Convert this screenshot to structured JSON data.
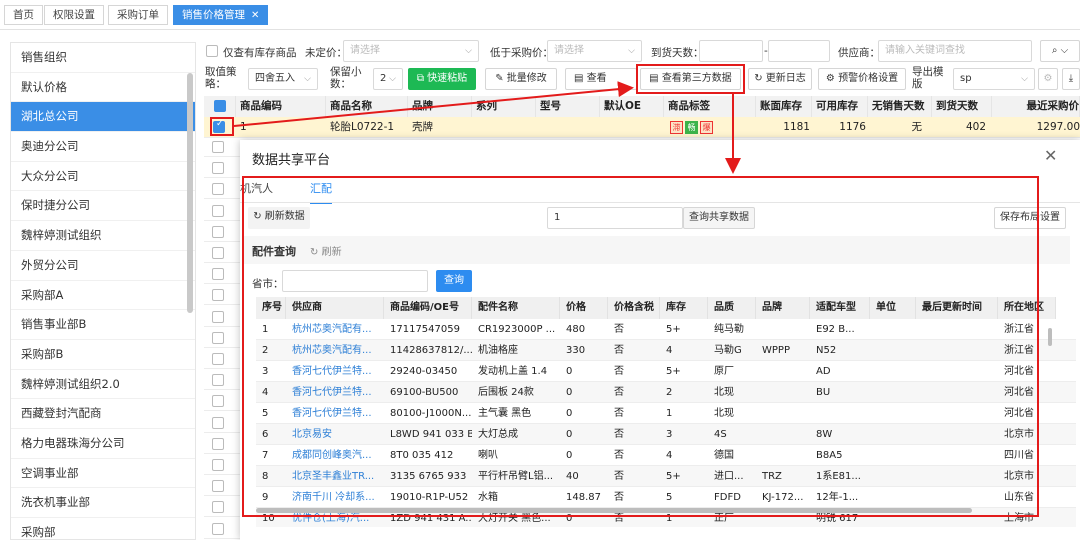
{
  "tabs": [
    {
      "label": "首页"
    },
    {
      "label": "权限设置"
    },
    {
      "label": "采购订单"
    },
    {
      "label": "销售价格管理",
      "active": true
    }
  ],
  "sidebar": {
    "items": [
      "销售组织",
      "默认价格",
      "湖北总公司",
      "奥迪分公司",
      "大众分公司",
      "保时捷分公司",
      "魏梓婷测试组织",
      "外贸分公司",
      "采购部A",
      "销售事业部B",
      "采购部B",
      "魏梓婷测试组织2.0",
      "西藏登封汽配商",
      "格力电器珠海分公司",
      "空调事业部",
      "洗衣机事业部",
      "采购部"
    ],
    "selected": 2
  },
  "filters": {
    "in_stock_only": "仅查有库存商品",
    "unpriced_label": "未定价：",
    "unpriced_placeholder": "请选择",
    "below_purchase_label": "低于采购价：",
    "below_purchase_placeholder": "请选择",
    "arrival_days_label": "到货天数：",
    "range_sep": "-",
    "supplier_label": "供应商：",
    "supplier_placeholder": "请输入关键词查找",
    "rounding_label_1": "取值策",
    "rounding_label_2": "略：",
    "rounding_value": "四舍五入",
    "decimals_label_1": "保留小",
    "decimals_label_2": "数：",
    "decimals_value": "2",
    "export_label_1": "导出模",
    "export_label_2": "版",
    "export_value": "sp"
  },
  "toolbar": {
    "quick_paste": "快速粘贴",
    "batch_edit": "批量修改",
    "view_fourth": "查看",
    "view_third_party": "查看第三方数据",
    "update_log": "更新日志",
    "price_alert": "预警价格设置"
  },
  "main_table": {
    "headers": [
      "商品编码",
      "商品名称",
      "品牌",
      "系列",
      "型号",
      "默认OE",
      "商品标签",
      "账面库存",
      "可用库存",
      "无销售天数",
      "到货天数",
      "最近采购价"
    ],
    "row1": {
      "code": "1",
      "name": "轮胎L0722-1",
      "brand": "壳牌",
      "tags": [
        "滞",
        "畅",
        "爆"
      ],
      "book_stock": "1181",
      "avail_stock": "1176",
      "no_sale_days": "无",
      "arrival_days": "402",
      "last_price": "1297.00"
    }
  },
  "modal": {
    "title": "数据共享平台",
    "tabs": [
      "机汽人",
      "汇配"
    ],
    "active_tab": 1,
    "refresh_data": "刷新数据",
    "query_input_value": "1",
    "query_shared": "查询共享数据",
    "save_layout": "保存布局设置",
    "section_title": "配件查询",
    "refresh": "刷新",
    "province_label": "省市：",
    "search": "查询",
    "headers": [
      "序号",
      "供应商",
      "商品编码/OE号",
      "配件名称",
      "价格",
      "价格含税",
      "库存",
      "品质",
      "品牌",
      "适配车型",
      "单位",
      "最后更新时间",
      "所在地区"
    ],
    "rows": [
      [
        "1",
        "杭州芯奥汽配有...",
        "17117547059",
        "CR1923000P ...",
        "480",
        "否",
        "5+",
        "纯马勒",
        "",
        "E92 B...",
        "",
        "",
        "浙江省"
      ],
      [
        "2",
        "杭州芯奥汽配有...",
        "11428637812/...",
        "机油格座",
        "330",
        "否",
        "4",
        "马勒G",
        "WPPP",
        "N52",
        "",
        "",
        "浙江省"
      ],
      [
        "3",
        "香河七代伊兰特...",
        "29240-03450",
        "发动机上盖 1.4",
        "0",
        "否",
        "5+",
        "原厂",
        "",
        "AD",
        "",
        "",
        "河北省"
      ],
      [
        "4",
        "香河七代伊兰特...",
        "69100-BU500",
        "后围板 24款",
        "0",
        "否",
        "2",
        "北现",
        "",
        "BU",
        "",
        "",
        "河北省"
      ],
      [
        "5",
        "香河七代伊兰特...",
        "80100-J1000N...",
        "主气囊 黑色",
        "0",
        "否",
        "1",
        "北现",
        "",
        "",
        "",
        "",
        "河北省"
      ],
      [
        "6",
        "北京易安",
        "L8WD 941 033 B",
        "大灯总成",
        "0",
        "否",
        "3",
        "4S",
        "",
        "8W",
        "",
        "",
        "北京市"
      ],
      [
        "7",
        "成都同创峰奥汽...",
        "8T0 035 412",
        "喇叭",
        "0",
        "否",
        "4",
        "德国",
        "",
        "B8A5",
        "",
        "",
        "四川省"
      ],
      [
        "8",
        "北京圣丰鑫业TR...",
        "3135 6765 933",
        "平行杆吊臂L铝...",
        "40",
        "否",
        "5+",
        "进口...",
        "TRZ",
        "1系E81...",
        "",
        "",
        "北京市"
      ],
      [
        "9",
        "济南千川 冷却系...",
        "19010-R1P-U52",
        "水箱",
        "148.87",
        "否",
        "5",
        "FDFD",
        "KJ-172...",
        "12年-1...",
        "",
        "",
        "山东省"
      ],
      [
        "10",
        "优件仓(上海)汽...",
        "1ZD 941 431 A...",
        "大灯开关 黑色...",
        "0",
        "否",
        "1",
        "正厂",
        "",
        "明锐 617",
        "",
        "",
        "上海市"
      ]
    ]
  }
}
